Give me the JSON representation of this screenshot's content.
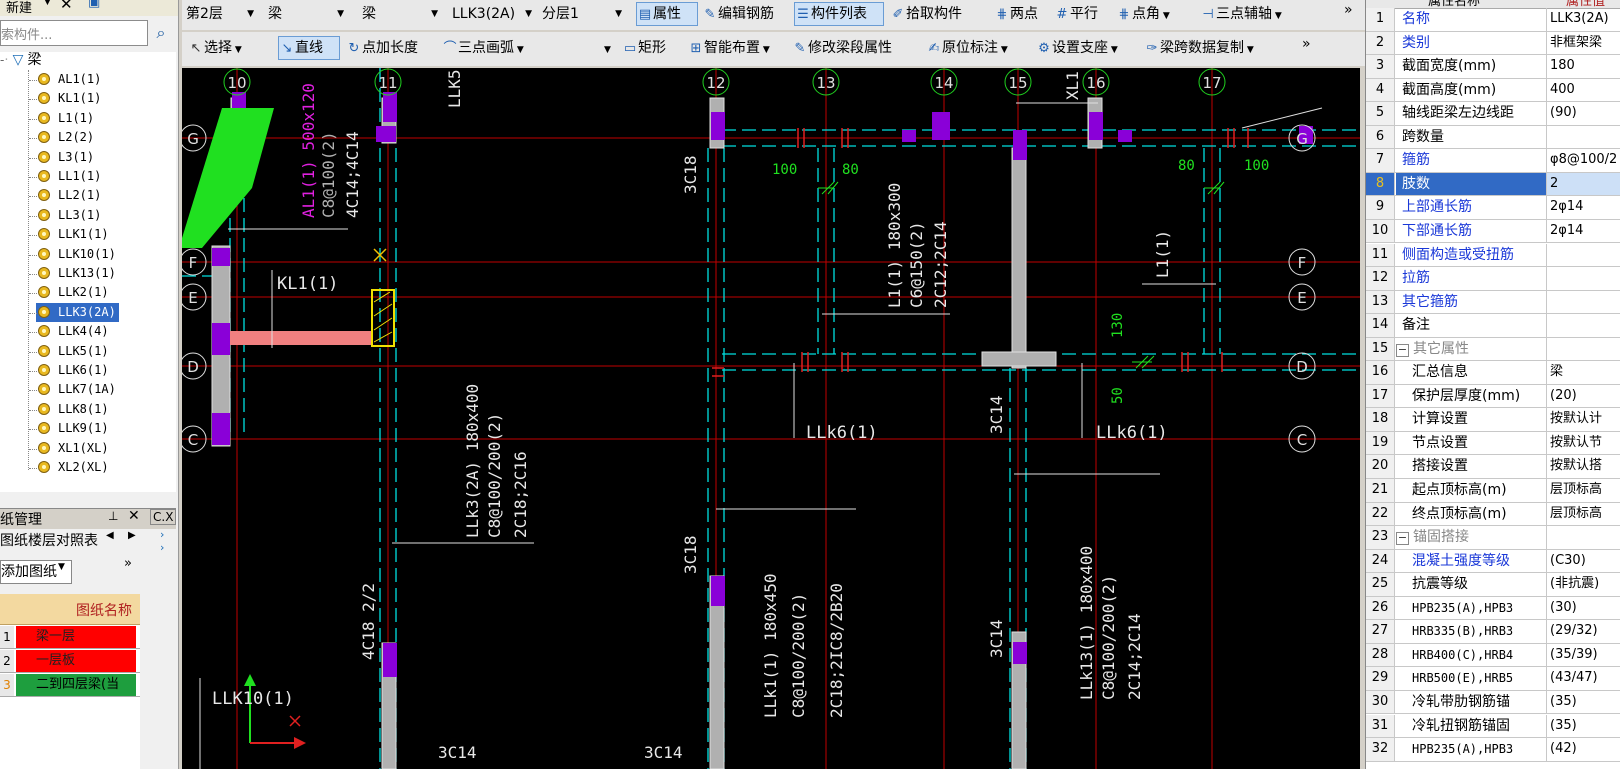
{
  "left_panel": {
    "top_new": "新建",
    "search_placeholder": "索构件...",
    "tree_root": "梁",
    "tree_items": [
      "AL1(1)",
      "KL1(1)",
      "L1(1)",
      "L2(2)",
      "L3(1)",
      "LL1(1)",
      "LL2(1)",
      "LL3(1)",
      "LLK1(1)",
      "LLK10(1)",
      "LLK13(1)",
      "LLK2(1)",
      "LLK3(2A)",
      "LLK4(4)",
      "LLK5(1)",
      "LLK6(1)",
      "LLK7(1A)",
      "LLK8(1)",
      "LLK9(1)",
      "XL1(XL)",
      "XL2(XL)"
    ],
    "selected_index": 12,
    "drawing_panel_title": "纸管理",
    "drawing_subtab": "图纸楼层对照表",
    "add_drawing": "添加图纸",
    "drawing_table_header": "图纸名称",
    "drawings": [
      {
        "num": "1",
        "name": "梁一层",
        "color": "#ff0000"
      },
      {
        "num": "2",
        "name": "一层板",
        "color": "#ff0000"
      },
      {
        "num": "3",
        "name": "二到四层梁(当",
        "color": "#1e9e3e"
      }
    ]
  },
  "toolbar1": {
    "floor": "第2层",
    "category": "梁",
    "type": "梁",
    "component": "LLK3(2A)",
    "sublayer": "分层1",
    "properties": "属性",
    "edit_rebar": "编辑钢筋",
    "component_list": "构件列表",
    "pick_component": "拾取构件",
    "two_points": "两点",
    "parallel": "平行",
    "point_angle": "点角",
    "three_point_aux": "三点辅轴"
  },
  "toolbar2": {
    "select": "选择",
    "line": "直线",
    "point_length": "点加长度",
    "three_point_arc": "三点画弧",
    "rectangle": "矩形",
    "smart_layout": "智能布置",
    "modify_segment": "修改梁段属性",
    "in_situ_mark": "原位标注",
    "set_support": "设置支座",
    "span_copy": "梁跨数据复制"
  },
  "cad": {
    "axis_numbers": [
      "10",
      "11",
      "12",
      "13",
      "14",
      "15",
      "16",
      "17"
    ],
    "axis_letters_left": [
      "G",
      "F",
      "E",
      "D",
      "C"
    ],
    "axis_letters_right": [
      "G",
      "F",
      "E",
      "D",
      "C"
    ],
    "labels": {
      "al1": "AL1(1) 500x120",
      "al1_b": "C8@100(2)",
      "al1_c": "4C14;4C14",
      "llk5": "LLK5",
      "kl1": "KL1(1)",
      "c3c18a": "3C18",
      "c3c18b": "3C18",
      "dim100a": "100",
      "dim80a": "80",
      "dim80b": "80",
      "dim100b": "100",
      "l1_a": "L1(1) 180x300",
      "l1_b": "C6@150(2)",
      "l1_c": "2C12;2C14",
      "xl": "XL1",
      "l1_right": "L1(1)",
      "d130": "130",
      "d50": "50",
      "llk6a": "LLk6(1)",
      "llk6b": "LLk6(1)",
      "llk3_a": "LLk3(2A) 180x400",
      "llk3_b": "C8@100/200(2)",
      "llk3_c": "2C18;2C16",
      "c3c14a": "3C14",
      "c3c14b": "3C14",
      "c4c18": "4C18 2/2",
      "llk1_a": "LLk1(1) 180x450",
      "llk1_b": "C8@100/200(2)",
      "llk1_c": "2C18;2IC8/2B20",
      "llk13_a": "LLk13(1) 180x400",
      "llk13_b": "C8@100/200(2)",
      "llk13_c": "2C14;2C14",
      "llk10": "LLK10(1)",
      "bottom1": "3C14",
      "bottom2": "3C14"
    }
  },
  "props": {
    "header": "属性名称",
    "header_val": "属性值",
    "rows": [
      {
        "n": "1",
        "name": "名称",
        "val": "LLK3(2A)",
        "style": "blue"
      },
      {
        "n": "2",
        "name": "类别",
        "val": "非框架梁",
        "style": "blue"
      },
      {
        "n": "3",
        "name": "截面宽度(mm)",
        "val": "180",
        "style": ""
      },
      {
        "n": "4",
        "name": "截面高度(mm)",
        "val": "400",
        "style": ""
      },
      {
        "n": "5",
        "name": "轴线距梁左边线距",
        "val": "(90)",
        "style": ""
      },
      {
        "n": "6",
        "name": "跨数量",
        "val": "",
        "style": ""
      },
      {
        "n": "7",
        "name": "箍筋",
        "val": "φ8@100/2",
        "style": "blue"
      },
      {
        "n": "8",
        "name": "肢数",
        "val": "2",
        "style": "sel"
      },
      {
        "n": "9",
        "name": "上部通长筋",
        "val": "2φ14",
        "style": "blue"
      },
      {
        "n": "10",
        "name": "下部通长筋",
        "val": "2φ14",
        "style": "blue"
      },
      {
        "n": "11",
        "name": "侧面构造或受扭筋",
        "val": "",
        "style": "blue"
      },
      {
        "n": "12",
        "name": "拉筋",
        "val": "",
        "style": "blue"
      },
      {
        "n": "13",
        "name": "其它箍筋",
        "val": "",
        "style": "blue"
      },
      {
        "n": "14",
        "name": "备注",
        "val": "",
        "style": ""
      },
      {
        "n": "15",
        "name": "其它属性",
        "val": "",
        "style": "group"
      },
      {
        "n": "16",
        "name": "汇总信息",
        "val": "梁",
        "style": "sub"
      },
      {
        "n": "17",
        "name": "保护层厚度(mm)",
        "val": "(20)",
        "style": "sub"
      },
      {
        "n": "18",
        "name": "计算设置",
        "val": "按默认计",
        "style": "sub"
      },
      {
        "n": "19",
        "name": "节点设置",
        "val": "按默认节",
        "style": "sub"
      },
      {
        "n": "20",
        "name": "搭接设置",
        "val": "按默认搭",
        "style": "sub"
      },
      {
        "n": "21",
        "name": "起点顶标高(m)",
        "val": "层顶标高",
        "style": "sub"
      },
      {
        "n": "22",
        "name": "终点顶标高(m)",
        "val": "层顶标高",
        "style": "sub"
      },
      {
        "n": "23",
        "name": "锚固搭接",
        "val": "",
        "style": "group"
      },
      {
        "n": "24",
        "name": "混凝土强度等级",
        "val": "(C30)",
        "style": "subblue"
      },
      {
        "n": "25",
        "name": "抗震等级",
        "val": "(非抗震)",
        "style": "sub"
      },
      {
        "n": "26",
        "name": "HPB235(A),HPB3",
        "val": "(30)",
        "style": "sub"
      },
      {
        "n": "27",
        "name": "HRB335(B),HRB3",
        "val": "(29/32)",
        "style": "sub"
      },
      {
        "n": "28",
        "name": "HRB400(C),HRB4",
        "val": "(35/39)",
        "style": "sub"
      },
      {
        "n": "29",
        "name": "HRB500(E),HRB5",
        "val": "(43/47)",
        "style": "sub"
      },
      {
        "n": "30",
        "name": "冷轧带肋钢筋锚",
        "val": "(35)",
        "style": "sub"
      },
      {
        "n": "31",
        "name": "冷轧扭钢筋锚固",
        "val": "(35)",
        "style": "sub"
      },
      {
        "n": "32",
        "name": "HPB235(A),HPB3",
        "val": "(42)",
        "style": "sub"
      }
    ]
  }
}
